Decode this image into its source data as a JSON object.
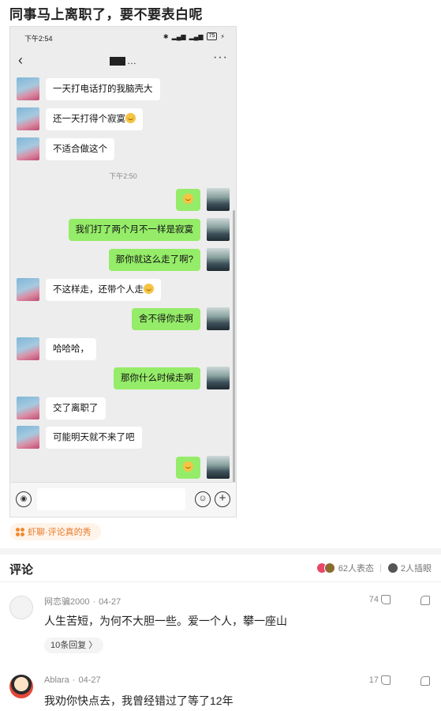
{
  "post": {
    "title": "同事马上离职了，要不要表白呢"
  },
  "phone": {
    "status": {
      "time": "下午2:54",
      "battery": "75"
    },
    "header": {
      "name": "…"
    },
    "messages": [
      {
        "side": "left",
        "text": "一天打电话打的我脑壳大",
        "emoji": false
      },
      {
        "side": "left",
        "text": "还一天打得个寂寞",
        "emoji": true
      },
      {
        "side": "left",
        "text": "不适合做这个",
        "emoji": false
      },
      {
        "side": "time",
        "text": "下午2:50"
      },
      {
        "side": "right",
        "text": "",
        "emoji": true
      },
      {
        "side": "right",
        "text": "我们打了两个月不一样是寂寞",
        "emoji": false
      },
      {
        "side": "right",
        "text": "那你就这么走了啊?",
        "emoji": false
      },
      {
        "side": "left",
        "text": "不这样走，还带个人走",
        "emoji": true
      },
      {
        "side": "right",
        "text": "舍不得你走啊",
        "emoji": false
      },
      {
        "side": "left",
        "text": "哈哈哈，",
        "emoji": false
      },
      {
        "side": "right",
        "text": "那你什么时候走啊",
        "emoji": false
      },
      {
        "side": "left",
        "text": "交了离职了",
        "emoji": false
      },
      {
        "side": "left",
        "text": "可能明天就不来了吧",
        "emoji": false
      },
      {
        "side": "right",
        "text": "",
        "emoji": true
      }
    ]
  },
  "topic": {
    "label": "虾聊·评论真的秀"
  },
  "comments_section": {
    "title": "评论",
    "reactions_count": "62人表态",
    "insert_count": "2人插眼",
    "colors": {
      "accent": "#e87a2a",
      "bubble_green": "#95ec69"
    }
  },
  "comments": [
    {
      "user": "网恋骗2000",
      "date": "04-27",
      "text": "人生苦短，为何不大胆一些。爱一个人，攀一座山",
      "likes": "74",
      "replies": "10条回复 〉"
    },
    {
      "user": "Ablara",
      "date": "04-27",
      "text": "我劝你快点去，我曾经错过了等了12年",
      "likes": "17"
    }
  ]
}
